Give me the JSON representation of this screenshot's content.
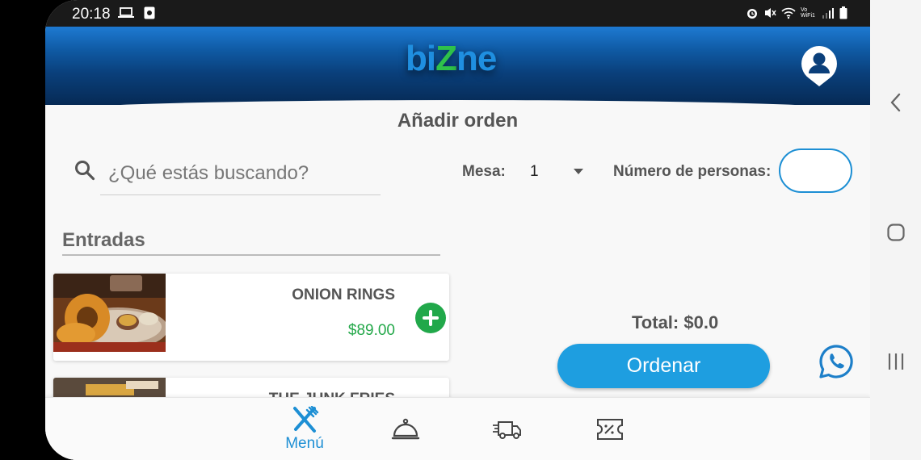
{
  "status_bar": {
    "time": "20:18",
    "left_icons": [
      "laptop-icon",
      "notification-icon"
    ],
    "right_icons": [
      "alarm-icon",
      "mute-icon",
      "wifi-icon",
      "vowifi-icon",
      "signal-icon",
      "battery-icon"
    ],
    "vowifi_text": "Vo WiFi1"
  },
  "header": {
    "logo": {
      "part1": "bi",
      "part2": "Z",
      "part3": "ne"
    },
    "profile_icon": "user-location-icon",
    "colors": {
      "header_top": "#1e7ad2",
      "header_bottom": "#062a55",
      "logo_blue": "#1f8fe0",
      "logo_green": "#2fc24a"
    }
  },
  "main": {
    "title": "Añadir orden",
    "search": {
      "placeholder": "¿Qué estás buscando?",
      "value": ""
    },
    "mesa": {
      "label": "Mesa:",
      "value": "1"
    },
    "personas": {
      "label": "Número de personas:",
      "value": ""
    },
    "section": {
      "title": "Entradas"
    },
    "products": [
      {
        "name": "ONION RINGS",
        "price": "$89.00",
        "image": "onion-rings-photo"
      },
      {
        "name": "THE JUNK FRIES",
        "price": "",
        "image": "fries-photo"
      }
    ],
    "total": "Total: $0.0",
    "order_button": "Ordenar",
    "whatsapp_icon": "whatsapp-icon",
    "colors": {
      "accent": "#1e9ee0",
      "price_green": "#24a84a",
      "add_green": "#21a84a"
    }
  },
  "bottom_nav": {
    "items": [
      {
        "label": "Menú",
        "icon": "fork-knife-icon",
        "active": true
      },
      {
        "label": "",
        "icon": "cloche-icon",
        "active": false
      },
      {
        "label": "",
        "icon": "delivery-truck-icon",
        "active": false
      },
      {
        "label": "",
        "icon": "coupon-icon",
        "active": false
      }
    ]
  },
  "android_nav": {
    "icons": [
      "back-icon",
      "home-icon",
      "recents-icon"
    ]
  }
}
